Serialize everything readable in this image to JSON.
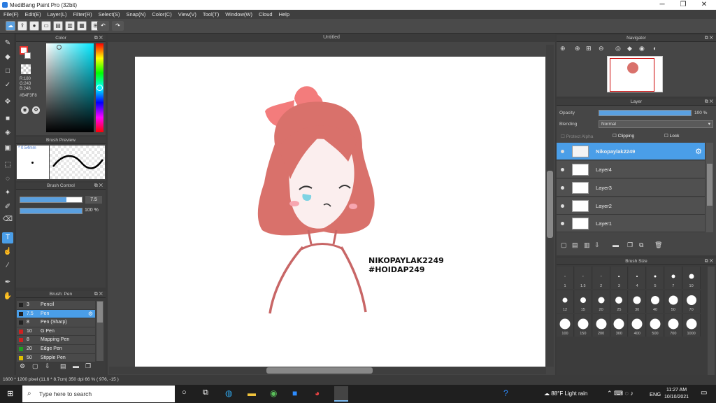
{
  "window": {
    "title": "MediBang Paint Pro (32bit)",
    "minimize": "─",
    "maximize": "❐",
    "close": "✕"
  },
  "menu": [
    "File(F)",
    "Edit(E)",
    "Layer(L)",
    "Filter(R)",
    "Select(S)",
    "Snap(N)",
    "Color(C)",
    "View(V)",
    "Tool(T)",
    "Window(W)",
    "Cloud",
    "Help"
  ],
  "panels": {
    "color": "Color",
    "brush_preview": "Brush Preview",
    "brush_control": "Brush Control",
    "brush_list": "Brush: Pen",
    "navigator": "Navigator",
    "layer": "Layer",
    "brush_size": "Brush Size"
  },
  "color": {
    "r": "R:180",
    "g": "G:243",
    "b": "B:248",
    "hex": "#B4F3F8",
    "current": "#e8322e"
  },
  "brush_preview": {
    "size": "* 0.54mm"
  },
  "brush_control": {
    "size_value": "7.5",
    "opacity_value": "100 %",
    "size_fill": 0.75,
    "opacity_fill": 1.0
  },
  "brushes": [
    {
      "size": "3",
      "name": "Pencil",
      "color": "#222222"
    },
    {
      "size": "7.5",
      "name": "Pen",
      "color": "#222222",
      "selected": true
    },
    {
      "size": "8",
      "name": "Pen (Sharp)",
      "color": "#222222"
    },
    {
      "size": "10",
      "name": "G Pen",
      "color": "#d02020"
    },
    {
      "size": "8",
      "name": "Mapping Pen",
      "color": "#d02020"
    },
    {
      "size": "20",
      "name": "Edge Pen",
      "color": "#20a020"
    },
    {
      "size": "50",
      "name": "Stipple Pen",
      "color": "#e0c000"
    }
  ],
  "document": {
    "tab": "Untitled"
  },
  "artwork": {
    "line1": "NIKOPAYLAK2249",
    "line2": "#HOIDAP249"
  },
  "layer_panel": {
    "opacity_label": "Opacity",
    "opacity_value": "100 %",
    "opacity_fill": 1.0,
    "blending_label": "Blending",
    "blending_value": "Normal",
    "protect_alpha": "Protect Alpha",
    "clipping": "Clipping",
    "lock": "Lock",
    "layers": [
      "Nikopaylak2249",
      "Layer4",
      "Layer3",
      "Layer2",
      "Layer1"
    ]
  },
  "brush_sizes": [
    [
      "1",
      "1.5",
      "2",
      "3",
      "4",
      "5",
      "7",
      "10"
    ],
    [
      "12",
      "15",
      "20",
      "25",
      "30",
      "40",
      "50",
      "70"
    ],
    [
      "100",
      "150",
      "200",
      "300",
      "400",
      "500",
      "700",
      "1000"
    ]
  ],
  "status": "1600 * 1200 pixel   (11.6 * 8.7cm)  350 dpi   66 %   ( 976, -15 )",
  "taskbar": {
    "search_placeholder": "Type here to search",
    "weather": "88°F  Light rain",
    "lang": "ENG",
    "time": "11:27 AM",
    "date": "10/10/2021"
  }
}
